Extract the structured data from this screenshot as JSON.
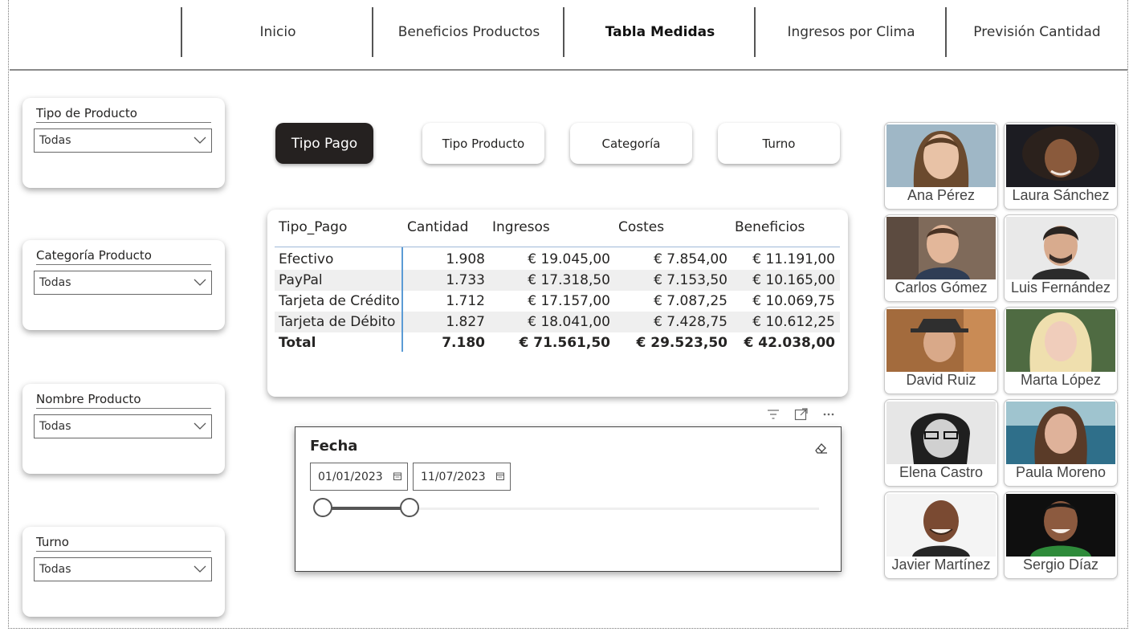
{
  "nav": {
    "items": [
      {
        "label": "Inicio"
      },
      {
        "label": "Beneficios Productos"
      },
      {
        "label": "Tabla Medidas"
      },
      {
        "label": "Ingresos por Clima"
      },
      {
        "label": "Previsión Cantidad"
      }
    ],
    "active": "Tabla Medidas"
  },
  "slicers": [
    {
      "title": "Tipo de Producto",
      "value": "Todas"
    },
    {
      "title": "Categoría Producto",
      "value": "Todas"
    },
    {
      "title": "Nombre Producto",
      "value": "Todas"
    },
    {
      "title": "Turno",
      "value": "Todas"
    }
  ],
  "measure_buttons": [
    {
      "label": "Tipo Pago"
    },
    {
      "label": "Tipo Producto"
    },
    {
      "label": "Categoría"
    },
    {
      "label": "Turno"
    }
  ],
  "table": {
    "headers": [
      "Tipo_Pago",
      "Cantidad",
      "Ingresos",
      "Costes",
      "Beneficios"
    ],
    "rows": [
      [
        "Efectivo",
        "1.908",
        "€ 19.045,00",
        "€ 7.854,00",
        "€ 11.191,00"
      ],
      [
        "PayPal",
        "1.733",
        "€ 17.318,50",
        "€ 7.153,50",
        "€ 10.165,00"
      ],
      [
        "Tarjeta de Crédito",
        "1.712",
        "€ 17.157,00",
        "€ 7.087,25",
        "€ 10.069,75"
      ],
      [
        "Tarjeta de Débito",
        "1.827",
        "€ 18.041,00",
        "€ 7.428,75",
        "€ 10.612,25"
      ]
    ],
    "total": [
      "Total",
      "7.180",
      "€ 71.561,50",
      "€ 29.523,50",
      "€ 42.038,00"
    ]
  },
  "date_slicer": {
    "title": "Fecha",
    "start": "01/01/2023",
    "end": "11/07/2023"
  },
  "people": [
    {
      "name": "Ana Pérez"
    },
    {
      "name": "Laura Sánchez"
    },
    {
      "name": "Carlos Gómez"
    },
    {
      "name": "Luis Fernández"
    },
    {
      "name": "David Ruiz"
    },
    {
      "name": "Marta López"
    },
    {
      "name": "Elena Castro"
    },
    {
      "name": "Paula Moreno"
    },
    {
      "name": "Javier Martínez"
    },
    {
      "name": "Sergio Díaz"
    }
  ],
  "colors": {
    "active_button_bg": "#252120",
    "table_divider": "#5b9bd5",
    "row_alt": "#efefef"
  },
  "icons": [
    "chevron-down-icon",
    "calendar-icon",
    "eraser-icon",
    "filter-icon",
    "focus-mode-icon",
    "more-options-icon"
  ]
}
